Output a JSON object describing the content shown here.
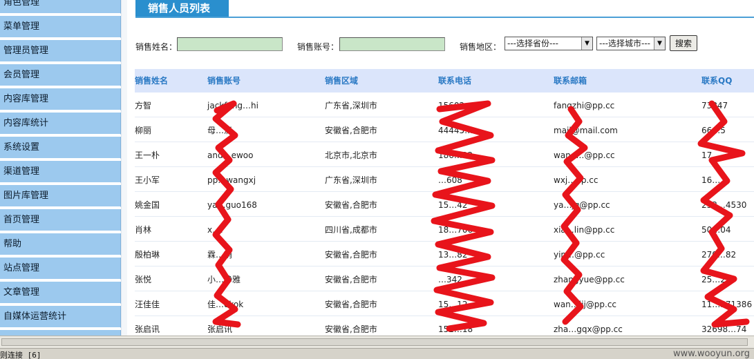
{
  "sidebar": {
    "items": [
      {
        "label": "角色管理"
      },
      {
        "label": "菜单管理"
      },
      {
        "label": "管理员管理"
      },
      {
        "label": "会员管理"
      },
      {
        "label": "内容库管理"
      },
      {
        "label": "内容库统计"
      },
      {
        "label": "系统设置"
      },
      {
        "label": "渠道管理"
      },
      {
        "label": "图片库管理"
      },
      {
        "label": "首页管理"
      },
      {
        "label": "帮助"
      },
      {
        "label": "站点管理"
      },
      {
        "label": "文章管理"
      },
      {
        "label": "自媒体运营统计"
      }
    ]
  },
  "page": {
    "title": "销售人员列表"
  },
  "search": {
    "name_label": "销售姓名：",
    "name_value": "",
    "account_label": "销售账号：",
    "account_value": "",
    "region_label": "销售地区：",
    "province_select": "---选择省份---",
    "city_select": "---选择城市---",
    "search_button": "搜索"
  },
  "table": {
    "headers": [
      "销售姓名",
      "销售账号",
      "销售区域",
      "联系电话",
      "联系邮箱",
      "联系QQ"
    ],
    "rows": [
      [
        "方智",
        "jackfang…hi",
        "广东省,深圳市",
        "15602…5",
        "fangzhi@pp.cc",
        "73847"
      ],
      [
        "柳丽",
        "母…滴",
        "安徽省,合肥市",
        "44445…",
        "mail@mail.com",
        "66…5"
      ],
      [
        "王一朴",
        "and…ewoo",
        "北京市,北京市",
        "186…22",
        "wang…@pp.cc",
        "17…"
      ],
      [
        "王小军",
        "pp…wangxj",
        "广东省,深圳市",
        "…608",
        "wxj…pp.cc",
        "16…"
      ],
      [
        "姚金国",
        "ya…guo168",
        "安徽省,合肥市",
        "15…42",
        "ya…jg@pp.cc",
        "253…4530"
      ],
      [
        "肖林",
        "x…l",
        "四川省,成都市",
        "18…706",
        "xia…lin@pp.cc",
        "50…04"
      ],
      [
        "殷柏琳",
        "霖…萌",
        "安徽省,合肥市",
        "13…82",
        "yin…@pp.cc",
        "270…82"
      ],
      [
        "张悦",
        "小…静雅",
        "安徽省,合肥市",
        "…342",
        "zhangyue@pp.cc",
        "25…210"
      ],
      [
        "汪佳佳",
        "佳…okok",
        "安徽省,合肥市",
        "15…12",
        "wan…ijj@pp.cc",
        "11…571386"
      ],
      [
        "张启讯",
        "张启讯",
        "安徽省,合肥市",
        "152…18",
        "zha…gqx@pp.cc",
        "32698…74"
      ]
    ]
  },
  "statusbar": {
    "text": "则连接 [6]",
    "watermark": "www.wooyun.org"
  },
  "colors": {
    "sidebar_bg": "#9cc9ee",
    "title_tab": "#2a8fce",
    "header_row": "#dbe5fb",
    "header_text": "#2a79c4",
    "input_bg": "#c9e6c8",
    "scribble": "#e8141b"
  },
  "icons": {
    "select_arrow": "triangle-down-icon"
  }
}
